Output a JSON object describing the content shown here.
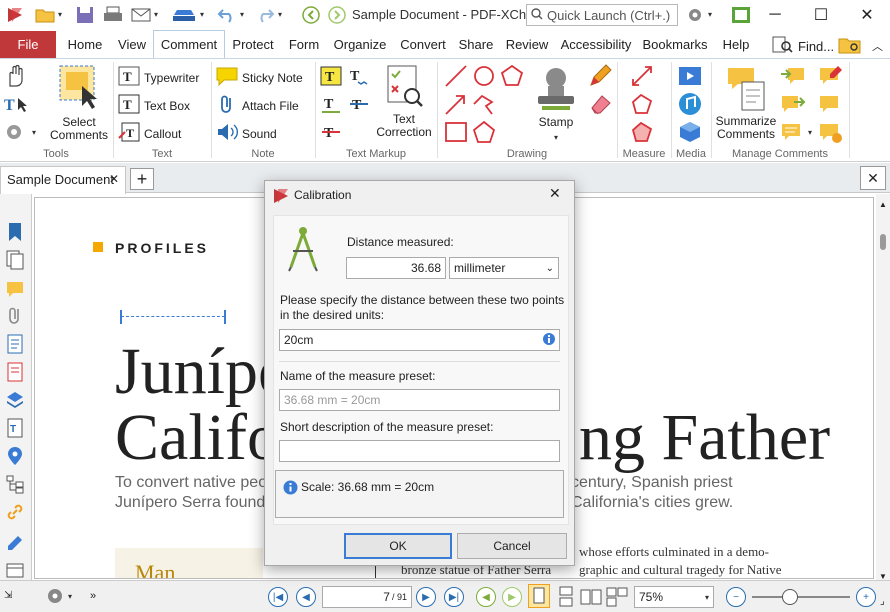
{
  "window": {
    "title": "Sample Document - PDF-XCha...",
    "quick_launch_placeholder": "Quick Launch (Ctrl+.)"
  },
  "menu_tabs": [
    "File",
    "Home",
    "View",
    "Comment",
    "Protect",
    "Form",
    "Organize",
    "Convert",
    "Share",
    "Review",
    "Accessibility",
    "Bookmarks",
    "Help"
  ],
  "find_label": "Find...",
  "ribbon": {
    "tools": {
      "select_comments": "Select Comments",
      "group": "Tools"
    },
    "text": {
      "typewriter": "Typewriter",
      "text_box": "Text Box",
      "callout": "Callout",
      "group": "Text"
    },
    "note": {
      "sticky_note": "Sticky Note",
      "attach_file": "Attach File",
      "sound": "Sound",
      "group": "Note"
    },
    "text_markup": {
      "text_correction": "Text Correction",
      "group": "Text Markup"
    },
    "drawing": {
      "stamp": "Stamp",
      "group": "Drawing"
    },
    "measure": {
      "group": "Measure"
    },
    "media": {
      "group": "Media"
    },
    "manage": {
      "summarize": "Summarize Comments",
      "group": "Manage Comments"
    }
  },
  "doc_tab": "Sample Document",
  "document": {
    "section": "PROFILES",
    "heading_line1": "Junípe",
    "heading_line2": "Califo",
    "heading_right": "ng Father",
    "para_left1": "To convert native peo",
    "para_left2": "Junípero Serra founde",
    "para_right1": "century, Spanish priest",
    "para_right2": "California's cities grew.",
    "col_right1": "whose efforts culminated in a demo-",
    "col_right2": "graphic and cultural tragedy for Native",
    "col_center": "bronze statue of Father Serra",
    "sidebar_word": "Man"
  },
  "dialog": {
    "title": "Calibration",
    "distance_label": "Distance measured:",
    "distance_value": "36.68",
    "unit": "millimeter",
    "specify_line1": "Please specify the distance between these two points",
    "specify_line2": "in the desired units:",
    "units_value": "20cm",
    "preset_name_label": "Name of the measure preset:",
    "preset_name_placeholder": "36.68 mm = 20cm",
    "preset_desc_label": "Short description of the measure preset:",
    "preset_desc_value": "",
    "scale_text": "Scale: 36.68 mm = 20cm",
    "ok": "OK",
    "cancel": "Cancel"
  },
  "status": {
    "page": "7",
    "total": "/ 91",
    "zoom": "75%"
  },
  "colors": {
    "file_tab": "#c1383b",
    "accent": "#2b6cb0",
    "heading_gold": "#f5a800",
    "icon_green": "#7cab3a",
    "icon_red": "#d9333a"
  }
}
